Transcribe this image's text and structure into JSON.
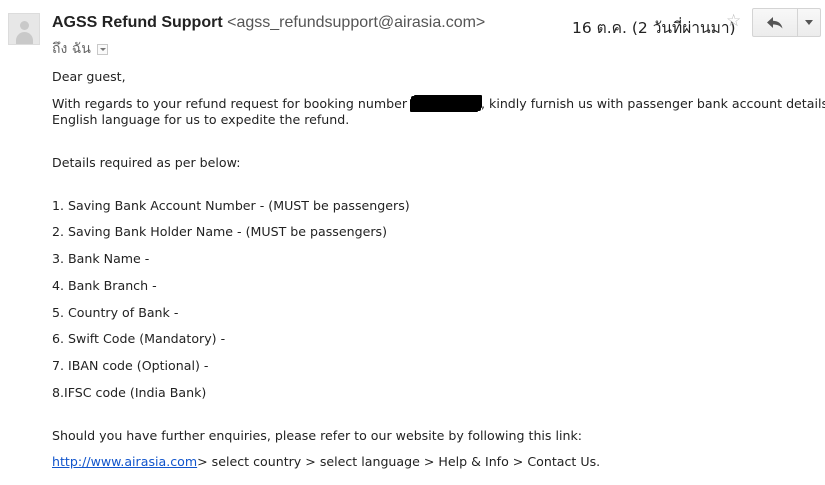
{
  "header": {
    "sender_name": "AGSS Refund Support",
    "sender_email": "<agss_refundsupport@airasia.com>",
    "date": "16 ต.ค. (2 วันที่ผ่านมา)",
    "to_label": "ถึง ฉัน",
    "icons": [
      "avatar-icon",
      "star-icon",
      "reply-icon",
      "dropdown-icon"
    ]
  },
  "email": {
    "greeting": "Dear guest,",
    "para1_before": "With regards to your refund request for booking number ",
    "para1_after": ", kindly furnish us with passenger bank account details in",
    "para1_line2": "English language for us to expedite the refund.",
    "details_intro": "Details required as per below:",
    "items": [
      "1. Saving Bank Account Number - (MUST be passengers)",
      "2. Saving Bank Holder Name - (MUST be passengers)",
      "3. Bank Name -",
      "4. Bank Branch -",
      "5. Country of Bank -",
      "6. Swift Code (Mandatory) -",
      "7. IBAN code (Optional) -",
      "8.IFSC code (India Bank)"
    ],
    "enquiry": "Should you have further enquiries, please refer to our website by following this link:",
    "link": "http://www.airasia.com",
    "link_after": "> select country > select language > Help & Info > Contact Us."
  },
  "colors": {
    "link": "#1155cc",
    "text": "#222222",
    "star": "#bbbbbb"
  }
}
